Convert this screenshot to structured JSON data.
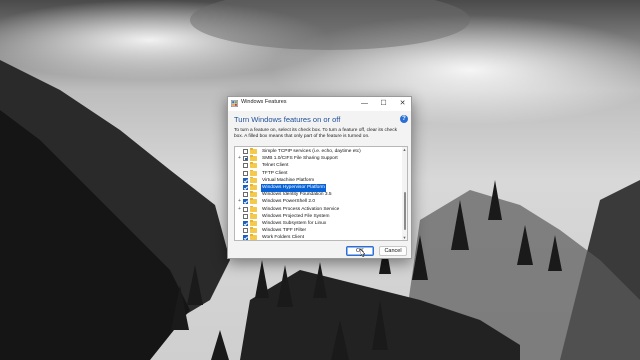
{
  "window": {
    "title": "Windows Features",
    "minimize_glyph": "—",
    "maximize_glyph": "☐",
    "close_glyph": "✕"
  },
  "heading": "Turn Windows features on or off",
  "help_glyph": "?",
  "description_lines": [
    "To turn a feature on, select its check box. To turn a feature off, clear its check",
    "box. A filled box means that only part of the feature is turned on."
  ],
  "features": [
    {
      "label": "Simple TCPIP services (i.e. echo, daytime etc)",
      "state": "unchecked",
      "expandable": false,
      "selected": false
    },
    {
      "label": "SMB 1.0/CIFS File Sharing Support",
      "state": "partial",
      "expandable": true,
      "selected": false
    },
    {
      "label": "Telnet Client",
      "state": "unchecked",
      "expandable": false,
      "selected": false
    },
    {
      "label": "TFTP Client",
      "state": "unchecked",
      "expandable": false,
      "selected": false
    },
    {
      "label": "Virtual Machine Platform",
      "state": "checked",
      "expandable": false,
      "selected": false
    },
    {
      "label": "Windows Hypervisor Platform",
      "state": "checked",
      "expandable": false,
      "selected": true
    },
    {
      "label": "Windows Identity Foundation 3.5",
      "state": "unchecked",
      "expandable": false,
      "selected": false
    },
    {
      "label": "Windows PowerShell 2.0",
      "state": "checked",
      "expandable": true,
      "selected": false
    },
    {
      "label": "Windows Process Activation Service",
      "state": "unchecked",
      "expandable": true,
      "selected": false
    },
    {
      "label": "Windows Projected File System",
      "state": "unchecked",
      "expandable": false,
      "selected": false
    },
    {
      "label": "Windows Subsystem for Linux",
      "state": "checked",
      "expandable": false,
      "selected": false
    },
    {
      "label": "Windows TIFF IFilter",
      "state": "unchecked",
      "expandable": false,
      "selected": false
    },
    {
      "label": "Work Folders Client",
      "state": "checked",
      "expandable": false,
      "selected": false
    }
  ],
  "buttons": {
    "ok": "OK",
    "cancel": "Cancel"
  },
  "colors": {
    "accent": "#0a63d4",
    "heading": "#1f4e9a",
    "folder": "#f4c94c"
  }
}
